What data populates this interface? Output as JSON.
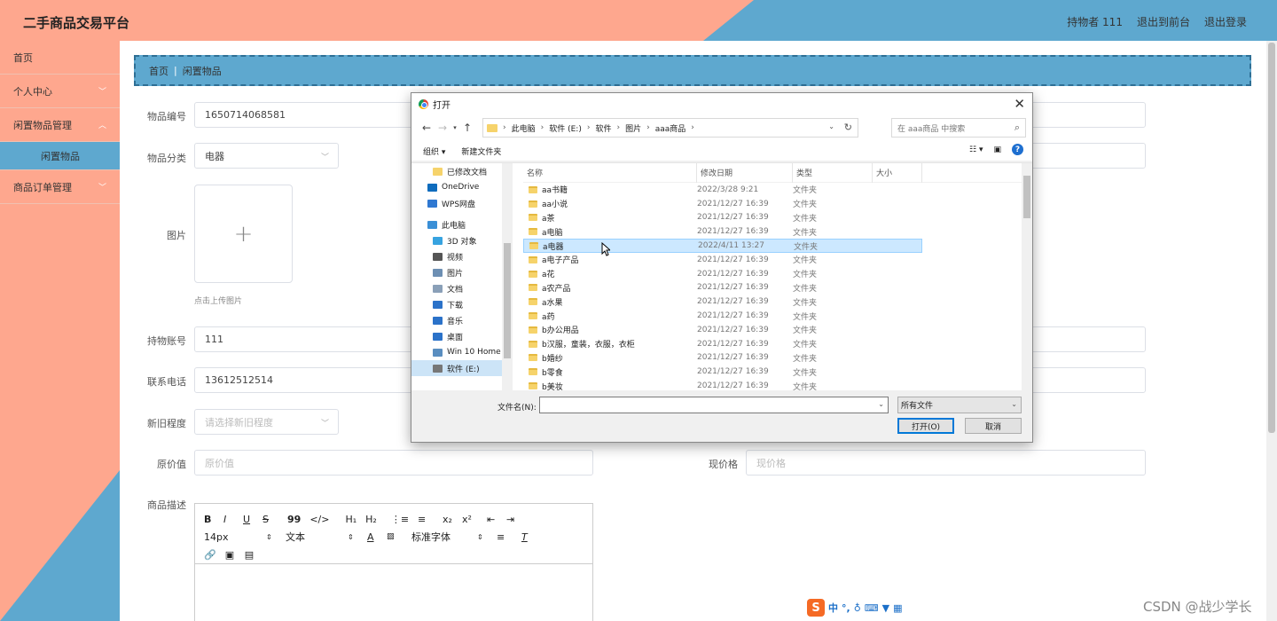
{
  "header": {
    "brand": "二手商品交易平台",
    "user": "持物者 111",
    "back_front": "退出到前台",
    "logout": "退出登录"
  },
  "sidebar": {
    "items": [
      {
        "label": "首页",
        "expandable": false
      },
      {
        "label": "个人中心",
        "expandable": true
      },
      {
        "label": "闲置物品管理",
        "expandable": true
      },
      {
        "label": "商品订单管理",
        "expandable": true
      }
    ],
    "sub_item": "闲置物品"
  },
  "breadcrumb": {
    "home": "首页",
    "sep": "|",
    "current": "闲置物品"
  },
  "form": {
    "item_no_label": "物品编号",
    "item_no_value": "1650714068581",
    "category_label": "物品分类",
    "category_value": "电器",
    "image_label": "图片",
    "upload_plus": "+",
    "upload_hint": "点击上传图片",
    "holder_label": "持物账号",
    "holder_value": "111",
    "phone_label": "联系电话",
    "phone_value": "13612512514",
    "condition_label": "新旧程度",
    "condition_placeholder": "请选择新旧程度",
    "orig_price_label": "原价值",
    "orig_price_placeholder": "原价值",
    "cur_price_label": "现价格",
    "cur_price_placeholder": "现价格",
    "desc_label": "商品描述"
  },
  "editor": {
    "row1": [
      "B",
      "I",
      "U",
      "S",
      "99",
      "</>",
      "H₁",
      "H₂",
      "⋮≡",
      "≡",
      "x₂",
      "x²",
      "⇤",
      "⇥"
    ],
    "size": "14px",
    "text_type": "文本",
    "font": "标准字体",
    "row3": [
      "🔗",
      "▣",
      "▤"
    ]
  },
  "dialog": {
    "title": "打开",
    "close": "✕",
    "path": [
      "此电脑",
      "软件 (E:)",
      "软件",
      "图片",
      "aaa商品"
    ],
    "search_placeholder": "在 aaa商品 中搜索",
    "organize": "组织 ▾",
    "new_folder": "新建文件夹",
    "nav_items": [
      {
        "label": "已修改文档",
        "icon": "folder-icon",
        "color": "#f6d36b"
      },
      {
        "label": "OneDrive",
        "icon": "cloud-icon",
        "color": "#0f6cbd"
      },
      {
        "label": "WPS网盘",
        "icon": "cloud-icon",
        "color": "#2f78d1"
      },
      {
        "label": "此电脑",
        "icon": "computer-icon",
        "color": "#3a8fd6"
      },
      {
        "label": "3D 对象",
        "icon": "cube-icon",
        "color": "#37a3e0"
      },
      {
        "label": "视频",
        "icon": "video-icon",
        "color": "#555555"
      },
      {
        "label": "图片",
        "icon": "picture-icon",
        "color": "#6d8fb3"
      },
      {
        "label": "文档",
        "icon": "document-icon",
        "color": "#8aa0b8"
      },
      {
        "label": "下载",
        "icon": "download-icon",
        "color": "#2b72c9"
      },
      {
        "label": "音乐",
        "icon": "music-icon",
        "color": "#2b72c9"
      },
      {
        "label": "桌面",
        "icon": "desktop-icon",
        "color": "#2b72c9"
      },
      {
        "label": "Win 10 Home",
        "icon": "drive-icon",
        "color": "#5a8ec0"
      },
      {
        "label": "软件 (E:)",
        "icon": "drive-icon",
        "color": "#777777"
      }
    ],
    "columns": {
      "name": "名称",
      "date": "修改日期",
      "type": "类型",
      "size": "大小"
    },
    "files": [
      {
        "name": "aa书籍",
        "date": "2022/3/28 9:21",
        "type": "文件夹"
      },
      {
        "name": "aa小说",
        "date": "2021/12/27 16:39",
        "type": "文件夹"
      },
      {
        "name": "a茶",
        "date": "2021/12/27 16:39",
        "type": "文件夹"
      },
      {
        "name": "a电脑",
        "date": "2021/12/27 16:39",
        "type": "文件夹"
      },
      {
        "name": "a电器",
        "date": "2022/4/11 13:27",
        "type": "文件夹"
      },
      {
        "name": "a电子产品",
        "date": "2021/12/27 16:39",
        "type": "文件夹"
      },
      {
        "name": "a花",
        "date": "2021/12/27 16:39",
        "type": "文件夹"
      },
      {
        "name": "a农产品",
        "date": "2021/12/27 16:39",
        "type": "文件夹"
      },
      {
        "name": "a水果",
        "date": "2021/12/27 16:39",
        "type": "文件夹"
      },
      {
        "name": "a药",
        "date": "2021/12/27 16:39",
        "type": "文件夹"
      },
      {
        "name": "b办公用品",
        "date": "2021/12/27 16:39",
        "type": "文件夹"
      },
      {
        "name": "b汉服，童装，衣服，衣柜",
        "date": "2021/12/27 16:39",
        "type": "文件夹"
      },
      {
        "name": "b婚纱",
        "date": "2021/12/27 16:39",
        "type": "文件夹"
      },
      {
        "name": "b零食",
        "date": "2021/12/27 16:39",
        "type": "文件夹"
      },
      {
        "name": "b美妆",
        "date": "2021/12/27 16:39",
        "type": "文件夹"
      }
    ],
    "selected_file": "a电器",
    "filename_label": "文件名(N):",
    "filename_value": "",
    "filter": "所有文件",
    "open": "打开(O)",
    "cancel": "取消"
  },
  "ime": {
    "logo": "S",
    "lang": "中"
  },
  "watermark": "CSDN @战少学长",
  "colors": {
    "salmon": "#fea78e",
    "blue": "#5ea8cf",
    "select": "#cce8ff"
  }
}
